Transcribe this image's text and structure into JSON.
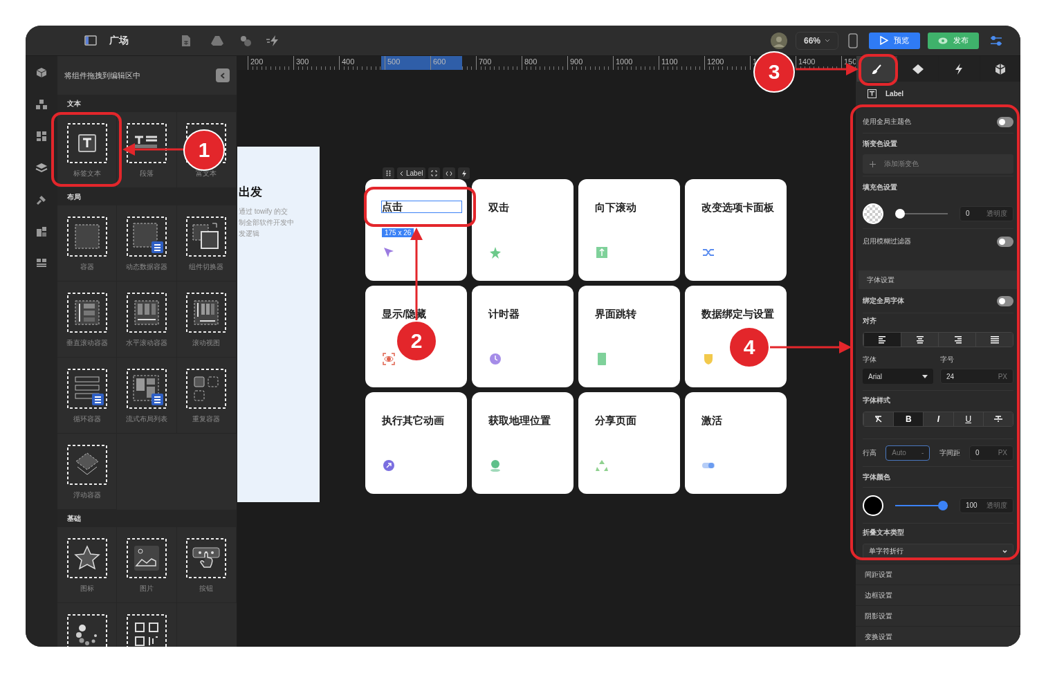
{
  "top_bar": {
    "title": "广场",
    "zoom": "66%",
    "preview_button": "预览",
    "publish_button": "发布"
  },
  "component_panel": {
    "header": "将组件拖拽到编辑区中",
    "sections": [
      {
        "title": "文本",
        "items": [
          {
            "kind": "label",
            "label": "标签文本"
          },
          {
            "kind": "paragraph",
            "label": "段落"
          },
          {
            "kind": "richtext",
            "label": "富文本"
          }
        ]
      },
      {
        "title": "布局",
        "items": [
          {
            "kind": "container",
            "label": "容器"
          },
          {
            "kind": "dynamic",
            "label": "动态数据容器"
          },
          {
            "kind": "switcher",
            "label": "组件切换器"
          },
          {
            "kind": "vscroll",
            "label": "垂直滚动容器"
          },
          {
            "kind": "hscroll",
            "label": "水平滚动容器"
          },
          {
            "kind": "scrollview",
            "label": "滚动视图"
          },
          {
            "kind": "loop",
            "label": "循环容器"
          },
          {
            "kind": "flow",
            "label": "流式布局列表"
          },
          {
            "kind": "repeat",
            "label": "重复容器"
          },
          {
            "kind": "float",
            "label": "浮动容器"
          }
        ]
      },
      {
        "title": "基础",
        "items": [
          {
            "kind": "icon",
            "label": "图标"
          },
          {
            "kind": "image",
            "label": "图片"
          },
          {
            "kind": "button",
            "label": "按钮"
          },
          {
            "kind": "loading"
          },
          {
            "kind": "qrcode"
          }
        ]
      }
    ]
  },
  "ruler": {
    "labels": [
      "200",
      "300",
      "400",
      "500",
      "600",
      "700",
      "800",
      "900",
      "1000",
      "1100",
      "1200",
      "1",
      "1400",
      "150"
    ]
  },
  "preview_page": {
    "title": "出发",
    "lines": [
      "通过 towify 的交",
      "制全部软件开发中",
      "发逻辑"
    ]
  },
  "selection_toolbar": {
    "breadcrumb": "Label"
  },
  "cards": [
    {
      "title": "点击",
      "selected": true,
      "size": "175 x 26",
      "color": "#9b7be0"
    },
    {
      "title": "双击",
      "selected": false,
      "color": "#6cc98a"
    },
    {
      "title": "向下滚动",
      "selected": false,
      "color": "#7fd19a"
    },
    {
      "title": "改变选项卡面板",
      "selected": false,
      "color": "#5b8def"
    },
    {
      "title": "显示/隐藏",
      "selected": false,
      "color": "#e0634f"
    },
    {
      "title": "计时器",
      "selected": false,
      "color": "#a58ce8"
    },
    {
      "title": "界面跳转",
      "selected": false,
      "color": "#7fd19a"
    },
    {
      "title": "数据绑定与设置",
      "selected": false,
      "color": "#f2c94c"
    },
    {
      "title": "执行其它动画",
      "selected": false,
      "color": "#7a6ee0"
    },
    {
      "title": "获取地理位置",
      "selected": false,
      "color": "#5fc08a"
    },
    {
      "title": "分享页面",
      "selected": false,
      "color": "#8fd18f"
    },
    {
      "title": "激活",
      "selected": false,
      "color": "#6b9cf0"
    }
  ],
  "right_panel": {
    "tabs": [
      {
        "selected": true
      },
      {
        "selected": false
      },
      {
        "selected": false
      },
      {
        "selected": false
      }
    ],
    "component_name": "Label",
    "global_theme": {
      "label": "使用全局主题色",
      "on": false
    },
    "gradient": {
      "title": "渐变色设置",
      "add": "添加渐变色"
    },
    "fill": {
      "title": "填充色设置",
      "level": 0,
      "value": "0",
      "hint": "透明度"
    },
    "blur": {
      "label": "启用模糊过滤器",
      "on": false
    },
    "font_section": "字体设置",
    "bind_font": {
      "label": "绑定全局字体",
      "on": false
    },
    "align": {
      "title": "对齐",
      "options": [
        {
          "selected": true
        },
        {
          "selected": false
        },
        {
          "selected": false
        },
        {
          "selected": false
        }
      ]
    },
    "font": {
      "label": "字体",
      "value": "Arial"
    },
    "font_size": {
      "label": "字号",
      "value": "24",
      "unit": "PX"
    },
    "font_style": {
      "title": "字体样式",
      "options": [
        {
          "kind": "clear",
          "selected": false
        },
        {
          "kind": "bold",
          "label": "B",
          "selected": true
        },
        {
          "kind": "italic",
          "label": "I",
          "selected": false
        },
        {
          "kind": "underline",
          "label": "U",
          "selected": false
        },
        {
          "kind": "strike",
          "selected": false
        }
      ]
    },
    "line_height": {
      "label": "行高",
      "placeholder": "Auto",
      "suffix": "-"
    },
    "letter_spacing": {
      "label": "字间距",
      "value": "0",
      "unit": "PX"
    },
    "font_color": {
      "title": "字体颜色",
      "level": 1,
      "value": "100",
      "hint": "透明度"
    },
    "wrap": {
      "title": "折叠文本类型",
      "value": "单字符折行"
    },
    "sections": [
      "间距设置",
      "边框设置",
      "阴影设置",
      "变换设置"
    ]
  },
  "annotations": [
    {
      "number": "1"
    },
    {
      "number": "2"
    },
    {
      "number": "3"
    },
    {
      "number": "4"
    }
  ]
}
